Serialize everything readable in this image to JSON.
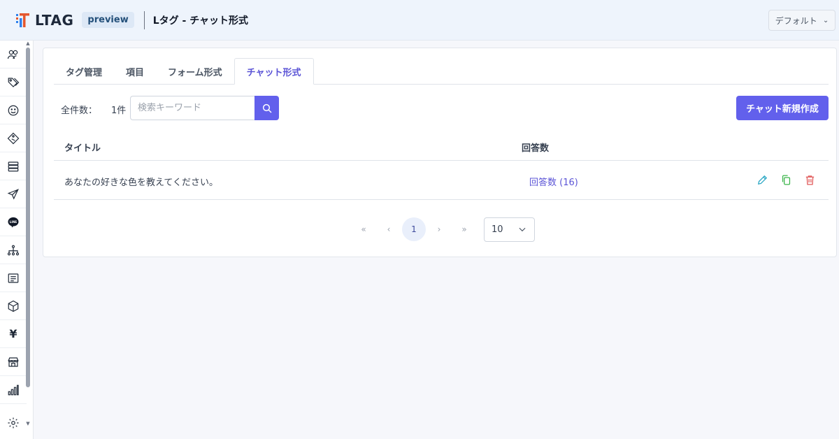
{
  "header": {
    "logo_text": "LTAG",
    "badge": "preview",
    "title": "Lタグ - チャット形式",
    "profile_select": "デフォルト"
  },
  "sidebar": {
    "items": [
      {
        "icon": "users-icon"
      },
      {
        "icon": "tags-icon"
      },
      {
        "icon": "smiley-icon"
      },
      {
        "icon": "diamond-tag-icon"
      },
      {
        "icon": "server-icon"
      },
      {
        "icon": "send-icon"
      },
      {
        "icon": "line-icon",
        "label": "LINE"
      },
      {
        "icon": "sitemap-icon"
      },
      {
        "icon": "document-icon"
      },
      {
        "icon": "box-icon"
      },
      {
        "icon": "yen-icon",
        "label": "¥"
      },
      {
        "icon": "store-icon"
      },
      {
        "icon": "bar-chart-icon"
      },
      {
        "icon": "gear-icon"
      }
    ]
  },
  "tabs": [
    {
      "label": "タグ管理",
      "active": false
    },
    {
      "label": "項目",
      "active": false
    },
    {
      "label": "フォーム形式",
      "active": false
    },
    {
      "label": "チャット形式",
      "active": true
    }
  ],
  "toolbar": {
    "total_label": "全件数：",
    "total_count": "1件",
    "search_placeholder": "検索キーワード",
    "new_button": "チャット新規作成"
  },
  "table": {
    "columns": [
      "タイトル",
      "回答数"
    ],
    "rows": [
      {
        "title": "あなたの好きな色を教えてください。",
        "answers": "回答数 (16)"
      }
    ]
  },
  "pagination": {
    "first": "«",
    "prev": "‹",
    "current": "1",
    "next": "›",
    "last": "»",
    "per_page": "10"
  },
  "colors": {
    "accent": "#6260ec",
    "edit": "#2aa7c4",
    "copy": "#3bb54a",
    "delete": "#e05858"
  }
}
